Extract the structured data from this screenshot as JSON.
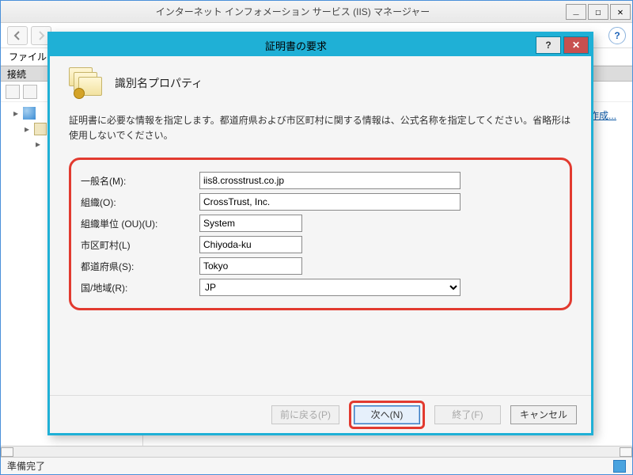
{
  "outerWindow": {
    "title": "インターネット インフォメーション サービス (IIS) マネージャー"
  },
  "menu": {
    "file": "ファイル"
  },
  "connections": {
    "header": "接続"
  },
  "actions": {
    "createLink": "作成..."
  },
  "statusbar": {
    "ready": "準備完了"
  },
  "dialog": {
    "title": "証明書の要求",
    "heading": "識別名プロパティ",
    "description": "証明書に必要な情報を指定します。都道府県および市区町村に関する情報は、公式名称を指定してください。省略形は使用しないでください。",
    "labels": {
      "commonName": "一般名(M):",
      "organization": "組織(O):",
      "orgUnit": "組織単位 (OU)(U):",
      "locality": "市区町村(L)",
      "state": "都道府県(S):",
      "country": "国/地域(R):"
    },
    "values": {
      "commonName": "iis8.crosstrust.co.jp",
      "organization": "CrossTrust, Inc.",
      "orgUnit": "System",
      "locality": "Chiyoda-ku",
      "state": "Tokyo",
      "country": "JP"
    },
    "buttons": {
      "back": "前に戻る(P)",
      "next": "次へ(N)",
      "finish": "終了(F)",
      "cancel": "キャンセル"
    },
    "helpSymbol": "?",
    "closeSymbol": "✕"
  },
  "colors": {
    "dialogAccent": "#1fb0d6",
    "highlightRed": "#e23a2f"
  }
}
